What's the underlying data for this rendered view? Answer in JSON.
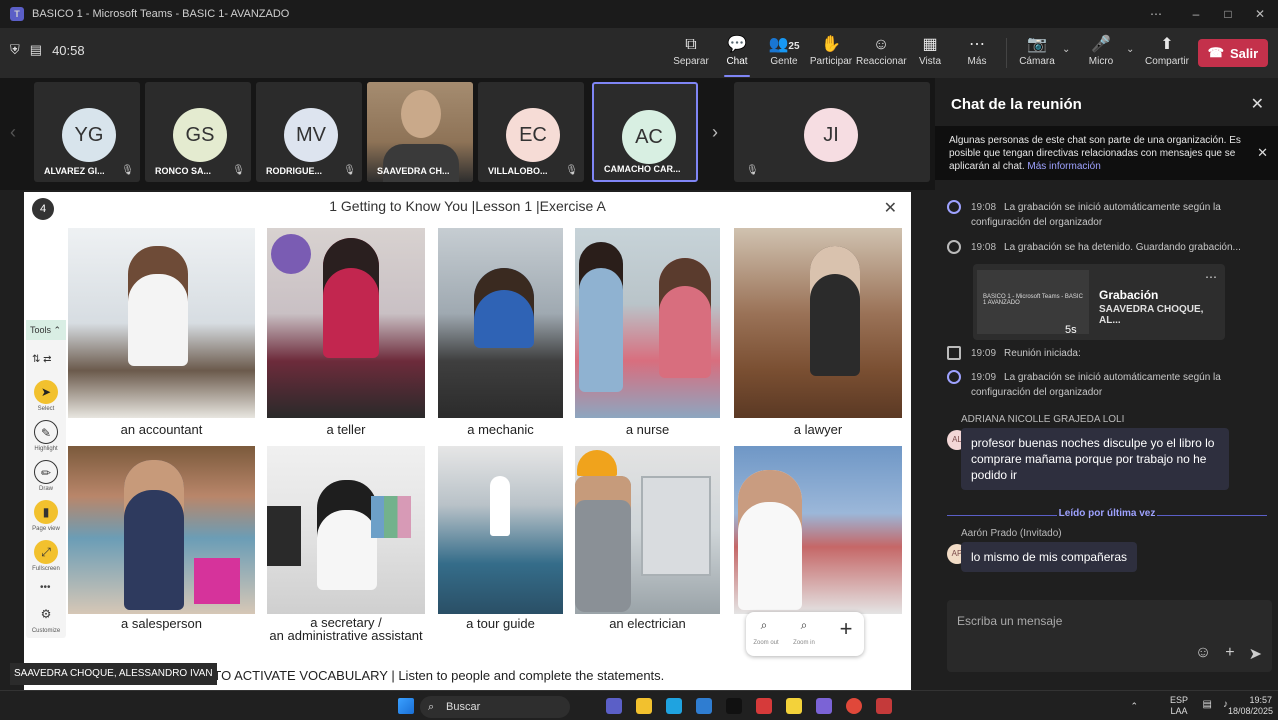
{
  "window": {
    "title": "BASICO 1 - Microsoft Teams - BASIC 1- AVANZADO",
    "min": "–",
    "max": "□",
    "close": "✕",
    "more": "⋯"
  },
  "toolbar": {
    "timer": "40:58",
    "items": [
      {
        "label": "Separar",
        "icon": "⧉"
      },
      {
        "label": "Chat",
        "icon": "💬"
      },
      {
        "label": "Gente",
        "icon": "👥",
        "count": "25"
      },
      {
        "label": "Participar",
        "icon": "✋"
      },
      {
        "label": "Reaccionar",
        "icon": "☺"
      },
      {
        "label": "Vista",
        "icon": "▦"
      },
      {
        "label": "Más",
        "icon": "⋯"
      },
      {
        "label": "Cámara",
        "icon": "📷"
      },
      {
        "label": "Micro",
        "icon": "🎤"
      },
      {
        "label": "Compartir",
        "icon": "⬆"
      }
    ],
    "leave": "Salir"
  },
  "participants": [
    {
      "initials": "YG",
      "name": "ALVAREZ GI...",
      "color": "#d8e4ec"
    },
    {
      "initials": "GS",
      "name": "RONCO SA...",
      "color": "#e4ebd0"
    },
    {
      "initials": "MV",
      "name": "RODRIGUE...",
      "color": "#dde4ef"
    },
    {
      "initials": "",
      "name": "SAAVEDRA CH...",
      "color": ""
    },
    {
      "initials": "EC",
      "name": "VILLALOBO...",
      "color": "#f6dcd6"
    },
    {
      "initials": "AC",
      "name": "CAMACHO CAR...",
      "color": "#d8efe2"
    },
    {
      "initials": "JI",
      "name": "",
      "color": "#f6dde2"
    }
  ],
  "share": {
    "badge": "4",
    "title": "1 Getting to Know You |Lesson 1 |Exercise A",
    "close": "✕",
    "captions": [
      "an accountant",
      "a teller",
      "a mechanic",
      "a nurse",
      "a lawyer",
      "a salesperson",
      "a secretary /",
      "an administrative assistant",
      "a tour guide",
      "an electrician"
    ],
    "tools": {
      "header": "Tools ⌃",
      "items": [
        "Select",
        "Highlight",
        "Draw",
        "Page view",
        "Fullscreen",
        "Customize"
      ]
    },
    "zoom": {
      "out": "Zoom out",
      "in": "Zoom in",
      "plus": "+"
    },
    "bottom": "TEN TO ACTIVATE VOCABULARY  |  Listen to people and complete the statements.",
    "speaker": "SAAVEDRA CHOQUE, ALESSANDRO IVAN"
  },
  "chat": {
    "title": "Chat de la reunión",
    "close": "✕",
    "banner_text": "Algunas personas de este chat son parte de una organización. Es posible que tengan directivas relacionadas con mensajes que se aplicarán al chat.",
    "banner_link": "Más información",
    "events": [
      {
        "time": "19:08",
        "text": "La grabación se inició automáticamente según la",
        "text2": "configuración del organizador"
      },
      {
        "time": "19:08",
        "text": "La grabación se ha detenido. Guardando grabación...",
        "text2": ""
      },
      {
        "time": "19:09",
        "text": "Reunión iniciada:",
        "text2": ""
      },
      {
        "time": "19:09",
        "text": "La grabación se inició automáticamente según la",
        "text2": "configuración del organizador"
      }
    ],
    "recording": {
      "title": "Grabación",
      "subtitle": "SAAVEDRA CHOQUE, AL...",
      "duration": "5s",
      "thumb": "BASICO 1 - Microsoft Teams - BASIC 1 AVANZADO"
    },
    "messages": [
      {
        "sender": "ADRIANA NICOLLE GRAJEDA LOLI",
        "initials": "AL",
        "text": "profesor buenas noches disculpe yo el libro lo comprare mañama porque por trabajo no he podido ir"
      },
      {
        "sender": "Aarón Prado (Invitado)",
        "initials": "AP",
        "text": "lo mismo de mis compañeras"
      }
    ],
    "last_read": "Leído por última vez",
    "compose_placeholder": "Escriba un mensaje"
  },
  "taskbar": {
    "search": "Buscar",
    "lang1": "ESP",
    "lang2": "LAA",
    "time": "19:57",
    "date": "18/08/2025"
  }
}
